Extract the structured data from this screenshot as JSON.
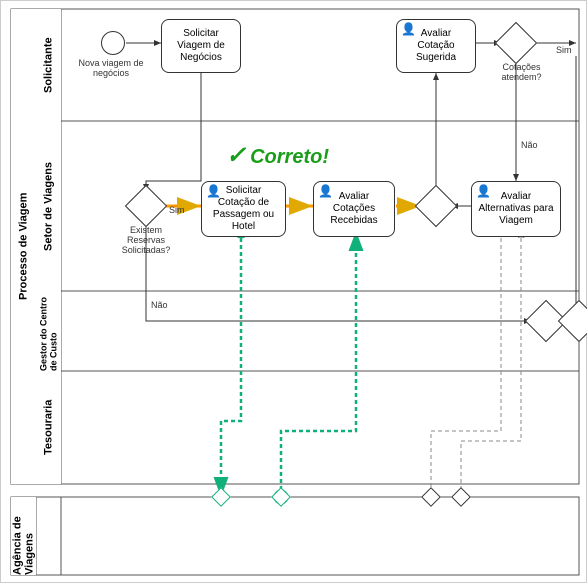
{
  "pool1": {
    "label": "Processo de Viagem"
  },
  "pool2": {
    "label": "Agência de Viagens"
  },
  "lanes": {
    "solicitante": "Solicitante",
    "setor": "Setor de Viagens",
    "gestor": "Gestor do Centro de Custo",
    "tesouraria": "Tesouraria"
  },
  "tasks": {
    "solicitar_viagem": "Solicitar Viagem de Negócios",
    "avaliar_cotacao_sugerida": "Avaliar Cotação Sugerida",
    "solicitar_cotacao": "Solicitar Cotação de Passagem ou Hotel",
    "avaliar_cotacoes_recebidas": "Avaliar Cotações Recebidas",
    "avaliar_alternativas": "Avaliar Alternativas para Viagem"
  },
  "labels": {
    "nova_viagem": "Nova viagem de negócios",
    "existem_reservas": "Existem Reservas Solicitadas?",
    "cotacoes_atendem": "Cotações atendem?",
    "sim": "Sim",
    "nao": "Não",
    "correto": "Correto!"
  },
  "chart_data": {
    "type": "bpmn-diagram",
    "pools": [
      {
        "id": "processo_viagem",
        "name": "Processo de Viagem",
        "lanes": [
          {
            "id": "solicitante",
            "name": "Solicitante"
          },
          {
            "id": "setor_viagens",
            "name": "Setor de Viagens"
          },
          {
            "id": "gestor_centro_custo",
            "name": "Gestor do Centro de Custo"
          },
          {
            "id": "tesouraria",
            "name": "Tesouraria"
          }
        ]
      },
      {
        "id": "agencia_viagens",
        "name": "Agência de Viagens",
        "lanes": []
      }
    ],
    "elements": [
      {
        "id": "start",
        "type": "start-event",
        "lane": "solicitante",
        "label": "Nova viagem de negócios"
      },
      {
        "id": "t1",
        "type": "task",
        "lane": "solicitante",
        "name": "Solicitar Viagem de Negócios"
      },
      {
        "id": "t2",
        "type": "user-task",
        "lane": "solicitante",
        "name": "Avaliar Cotação Sugerida"
      },
      {
        "id": "g1",
        "type": "exclusive-gateway",
        "lane": "solicitante",
        "label": "Cotações atendem?"
      },
      {
        "id": "g2",
        "type": "exclusive-gateway",
        "lane": "setor_viagens",
        "label": "Existem Reservas Solicitadas?"
      },
      {
        "id": "t3",
        "type": "user-task",
        "lane": "setor_viagens",
        "name": "Solicitar Cotação de Passagem ou Hotel"
      },
      {
        "id": "t4",
        "type": "user-task",
        "lane": "setor_viagens",
        "name": "Avaliar Cotações Recebidas"
      },
      {
        "id": "g3",
        "type": "exclusive-gateway",
        "lane": "setor_viagens"
      },
      {
        "id": "t5",
        "type": "user-task",
        "lane": "setor_viagens",
        "name": "Avaliar Alternativas para Viagem"
      },
      {
        "id": "g4",
        "type": "exclusive-gateway",
        "lane": "gestor_centro_custo"
      },
      {
        "id": "g5",
        "type": "exclusive-gateway",
        "lane": "gestor_centro_custo"
      }
    ],
    "sequence_flows": [
      {
        "from": "start",
        "to": "t1"
      },
      {
        "from": "t1",
        "to": "g2"
      },
      {
        "from": "g2",
        "to": "t3",
        "label": "Sim",
        "highlight": "yellow"
      },
      {
        "from": "t3",
        "to": "t4",
        "highlight": "yellow"
      },
      {
        "from": "t4",
        "to": "g3",
        "highlight": "yellow"
      },
      {
        "from": "g3",
        "to": "t2"
      },
      {
        "from": "t2",
        "to": "g1"
      },
      {
        "from": "g1",
        "to": "t5",
        "label": "Não"
      },
      {
        "from": "g1",
        "to": "out_right",
        "label": "Sim"
      },
      {
        "from": "t5",
        "to": "g3"
      },
      {
        "from": "g2",
        "to": "g4",
        "label": "Não"
      },
      {
        "from": "g4",
        "to": "g5"
      }
    ],
    "message_flows": [
      {
        "from": "t3",
        "to": "agencia_viagens",
        "highlight": "green"
      },
      {
        "from": "agencia_viagens",
        "to": "t4",
        "highlight": "green"
      },
      {
        "from": "t5",
        "to": "agencia_viagens"
      },
      {
        "from": "agencia_viagens",
        "to": "t5"
      }
    ],
    "annotations": [
      {
        "type": "callout",
        "text": "Correto!",
        "style": "green-check",
        "near": "t3/t4"
      }
    ]
  }
}
